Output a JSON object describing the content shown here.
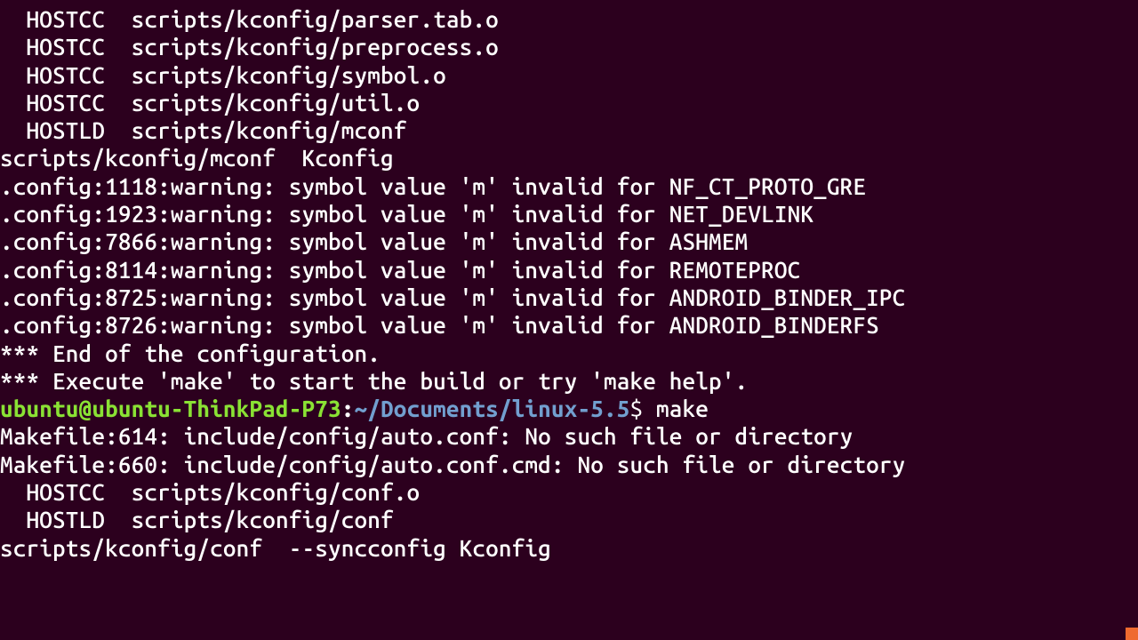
{
  "colors": {
    "background": "#2c001e",
    "text": "#ffffff",
    "prompt_user": "#8ae234",
    "prompt_path": "#729fcf",
    "scroll_cue": "#ef6a2f"
  },
  "build_lines": [
    "  HOSTCC  scripts/kconfig/parser.tab.o",
    "  HOSTCC  scripts/kconfig/preprocess.o",
    "  HOSTCC  scripts/kconfig/symbol.o",
    "  HOSTCC  scripts/kconfig/util.o",
    "  HOSTLD  scripts/kconfig/mconf",
    "scripts/kconfig/mconf  Kconfig"
  ],
  "warnings": [
    ".config:1118:warning: symbol value 'm' invalid for NF_CT_PROTO_GRE",
    ".config:1923:warning: symbol value 'm' invalid for NET_DEVLINK",
    ".config:7866:warning: symbol value 'm' invalid for ASHMEM",
    ".config:8114:warning: symbol value 'm' invalid for REMOTEPROC",
    ".config:8725:warning: symbol value 'm' invalid for ANDROID_BINDER_IPC",
    ".config:8726:warning: symbol value 'm' invalid for ANDROID_BINDERFS"
  ],
  "blank_after_warnings": [
    "",
    ""
  ],
  "config_end": [
    "*** End of the configuration.",
    "*** Execute 'make' to start the build or try 'make help'."
  ],
  "blank_before_prompt": "",
  "prompt": {
    "user_host": "ubuntu@ubuntu-ThinkPad-P73",
    "sep": ":",
    "path": "~/Documents/linux-5.5",
    "dollar": "$ ",
    "command": "make"
  },
  "post_make": [
    "Makefile:614: include/config/auto.conf: No such file or directory",
    "Makefile:660: include/config/auto.conf.cmd: No such file or directory",
    "  HOSTCC  scripts/kconfig/conf.o",
    "  HOSTLD  scripts/kconfig/conf",
    "scripts/kconfig/conf  --syncconfig Kconfig"
  ]
}
